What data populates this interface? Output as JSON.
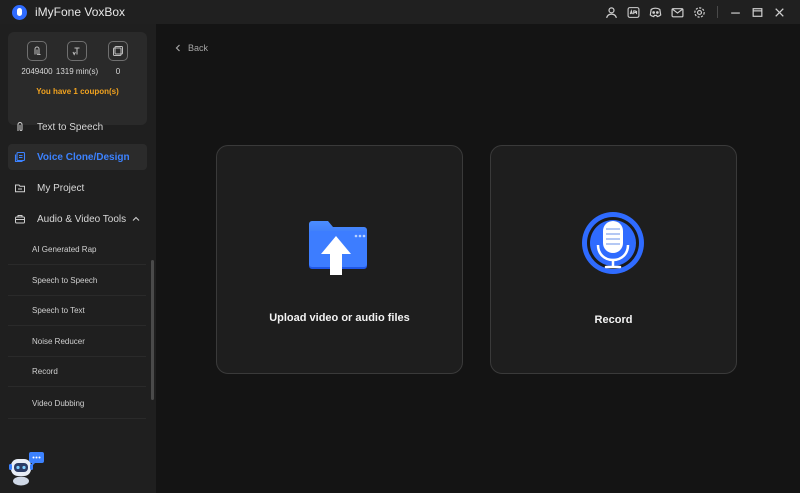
{
  "app": {
    "title": "iMyFone VoxBox"
  },
  "titlebar": {
    "icons": [
      "user-icon",
      "app-icon",
      "discord-icon",
      "mail-icon",
      "settings-icon",
      "minimize-icon",
      "maximize-icon",
      "close-icon"
    ]
  },
  "sidebar": {
    "stats": [
      {
        "icon": "character-count-icon",
        "value": "2049400"
      },
      {
        "icon": "minutes-icon",
        "value": "1319 min(s)"
      },
      {
        "icon": "clone-count-icon",
        "value": "0"
      }
    ],
    "coupon_text": "You have 1 coupon(s)",
    "nav": [
      {
        "label": "Text to Speech",
        "icon": "text-to-speech-icon"
      },
      {
        "label": "Voice Clone/Design",
        "icon": "voice-clone-icon",
        "active": true
      },
      {
        "label": "My Project",
        "icon": "folder-icon"
      },
      {
        "label": "Audio & Video Tools",
        "icon": "toolbox-icon"
      }
    ],
    "tools": [
      {
        "label": "AI Generated Rap"
      },
      {
        "label": "Speech to Speech"
      },
      {
        "label": "Speech to Text"
      },
      {
        "label": "Noise Reducer"
      },
      {
        "label": "Record"
      },
      {
        "label": "Video Dubbing"
      }
    ]
  },
  "main": {
    "back_label": "Back",
    "cards": [
      {
        "label": "Upload video or audio files",
        "icon": "upload-folder-icon"
      },
      {
        "label": "Record",
        "icon": "microphone-icon"
      }
    ]
  },
  "colors": {
    "accent": "#2f6bff",
    "active_text": "#3c82ff",
    "coupon": "#f2a31f"
  }
}
